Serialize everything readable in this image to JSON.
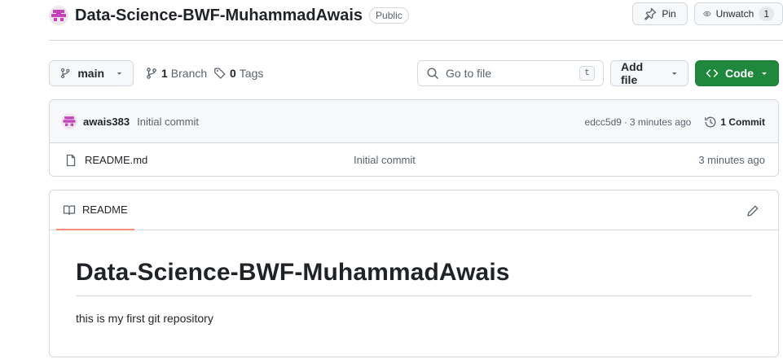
{
  "repo": {
    "name": "Data-Science-BWF-MuhammadAwais",
    "visibility": "Public"
  },
  "header_actions": {
    "pin_label": "Pin",
    "watch_label": "Unwatch",
    "watch_count": "1"
  },
  "toolbar": {
    "branch_name": "main",
    "branch_count": "1",
    "branch_label": "Branch",
    "tag_count": "0",
    "tag_label": "Tags",
    "search_placeholder": "Go to file",
    "search_shortcut": "t",
    "add_file_label": "Add file",
    "code_label": "Code"
  },
  "latest_commit": {
    "author": "awais383",
    "message": "Initial commit",
    "sha": "edcc5d9",
    "separator": "·",
    "age": "3 minutes ago",
    "commits_count": "1 Commit"
  },
  "files": [
    {
      "name": "README.md",
      "commit_message": "Initial commit",
      "age": "3 minutes ago"
    }
  ],
  "readme": {
    "tab_label": "README",
    "heading": "Data-Science-BWF-MuhammadAwais",
    "paragraph": "this is my first git repository"
  },
  "colors": {
    "code_button": "#1f883d",
    "tab_underline": "#fd8c73",
    "avatar": "#c342b8"
  }
}
